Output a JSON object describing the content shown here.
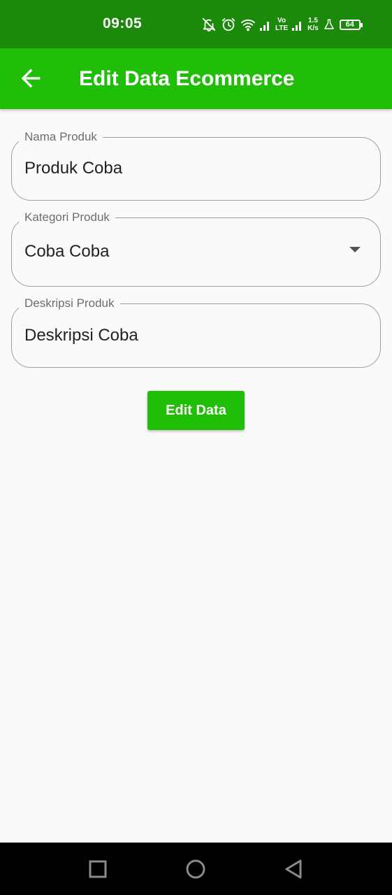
{
  "status_bar": {
    "time": "09:05",
    "volte_top": "Vo",
    "volte_bottom": "LTE",
    "speed_value": "1.5",
    "speed_unit": "K/s",
    "battery": "64"
  },
  "app_bar": {
    "title": "Edit Data Ecommerce",
    "back_icon": "arrow-back-icon"
  },
  "form": {
    "nama_produk": {
      "label": "Nama Produk",
      "value": "Produk Coba"
    },
    "kategori_produk": {
      "label": "Kategori Produk",
      "value": "Coba Coba"
    },
    "deskripsi_produk": {
      "label": "Deskripsi Produk",
      "value": "Deskripsi Coba"
    }
  },
  "submit_button": {
    "label": "Edit Data"
  },
  "colors": {
    "status_bar": "#1b8a0b",
    "app_bar": "#21be08",
    "button": "#21be08",
    "background": "#fafafa",
    "nav_bar": "#000000"
  },
  "nav_bar": {
    "icons": [
      "recent-apps-icon",
      "home-icon",
      "back-nav-icon"
    ]
  }
}
